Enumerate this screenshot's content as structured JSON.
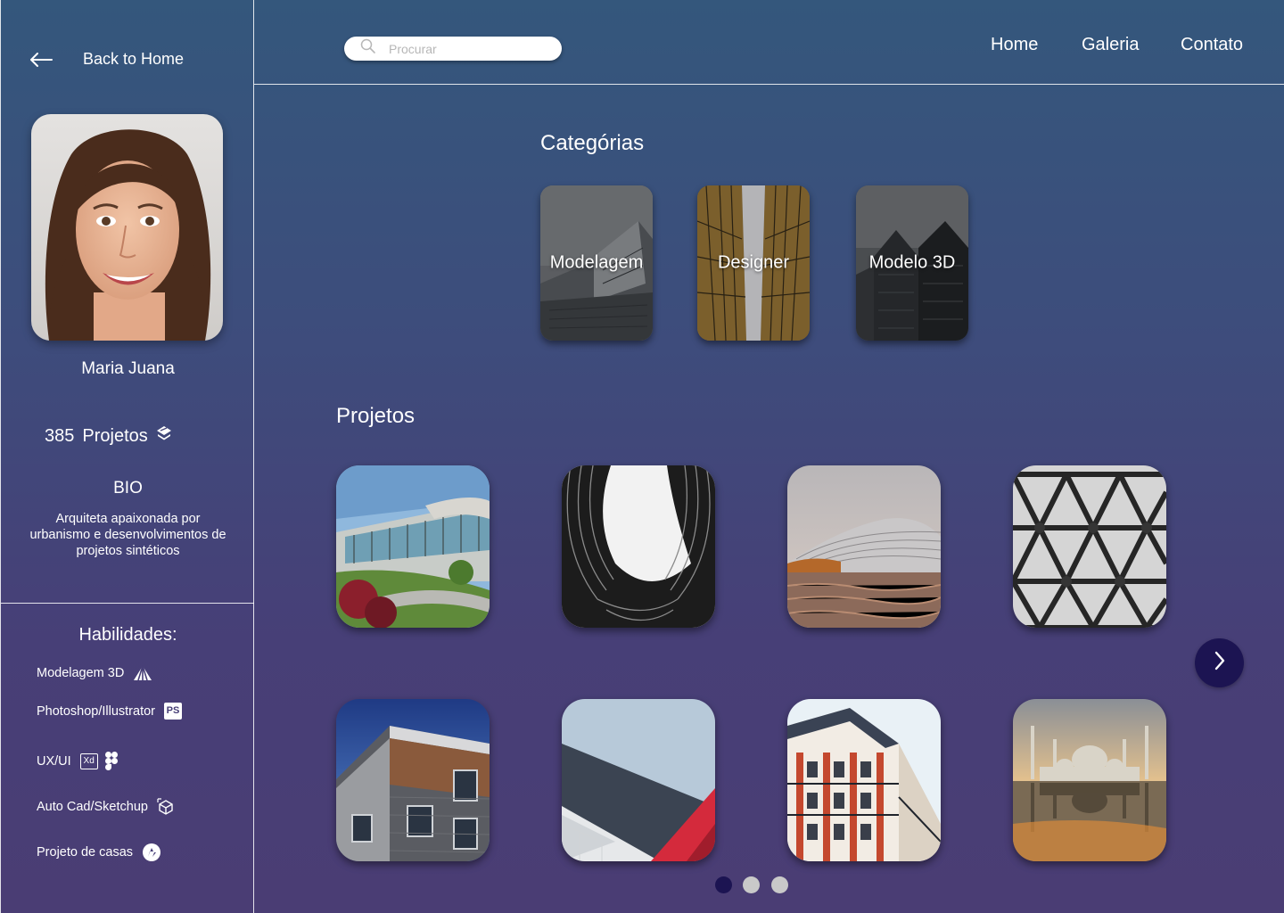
{
  "sidebar": {
    "back_label": "Back to Home",
    "profile_name": "Maria Juana",
    "projects_count": "385",
    "projects_label": "Projetos",
    "bio_title": "BIO",
    "bio_text": "Arquiteta apaixonada por urbanismo e desenvolvimentos de projetos sintéticos",
    "skills_title": "Habilidades:",
    "skills": [
      {
        "label": "Modelagem 3D",
        "icon": "pyramid-icon"
      },
      {
        "label": "Photoshop/Illustrator",
        "icon": "photoshop-icon",
        "badge": "PS"
      },
      {
        "label": "UX/UI",
        "icon": "xd-figma-icon",
        "badge": "Xd"
      },
      {
        "label": "Auto Cad/Sketchup",
        "icon": "sketchup-cube-icon"
      },
      {
        "label": "Projeto de casas",
        "icon": "house-project-icon"
      }
    ]
  },
  "header": {
    "search_placeholder": "Procurar",
    "nav": [
      "Home",
      "Galeria",
      "Contato"
    ]
  },
  "categories": {
    "title": "Categórias",
    "items": [
      "Modelagem",
      "Designer",
      "Modelo 3D"
    ]
  },
  "projects": {
    "title": "Projetos",
    "items": [
      "green-roof-building",
      "black-curved-towers",
      "wavy-roof-waterfront",
      "triangular-glass-ceiling",
      "grey-brick-corner-building",
      "red-white-facade",
      "parisian-apartment",
      "mosque-reflection"
    ]
  },
  "pagination": {
    "pages": 3,
    "active": 1
  },
  "colors": {
    "accent_dark": "#1c1452",
    "dot_inactive": "#c9c9c9",
    "bg_top": "#34577c",
    "bg_bottom": "#4a3d74"
  }
}
